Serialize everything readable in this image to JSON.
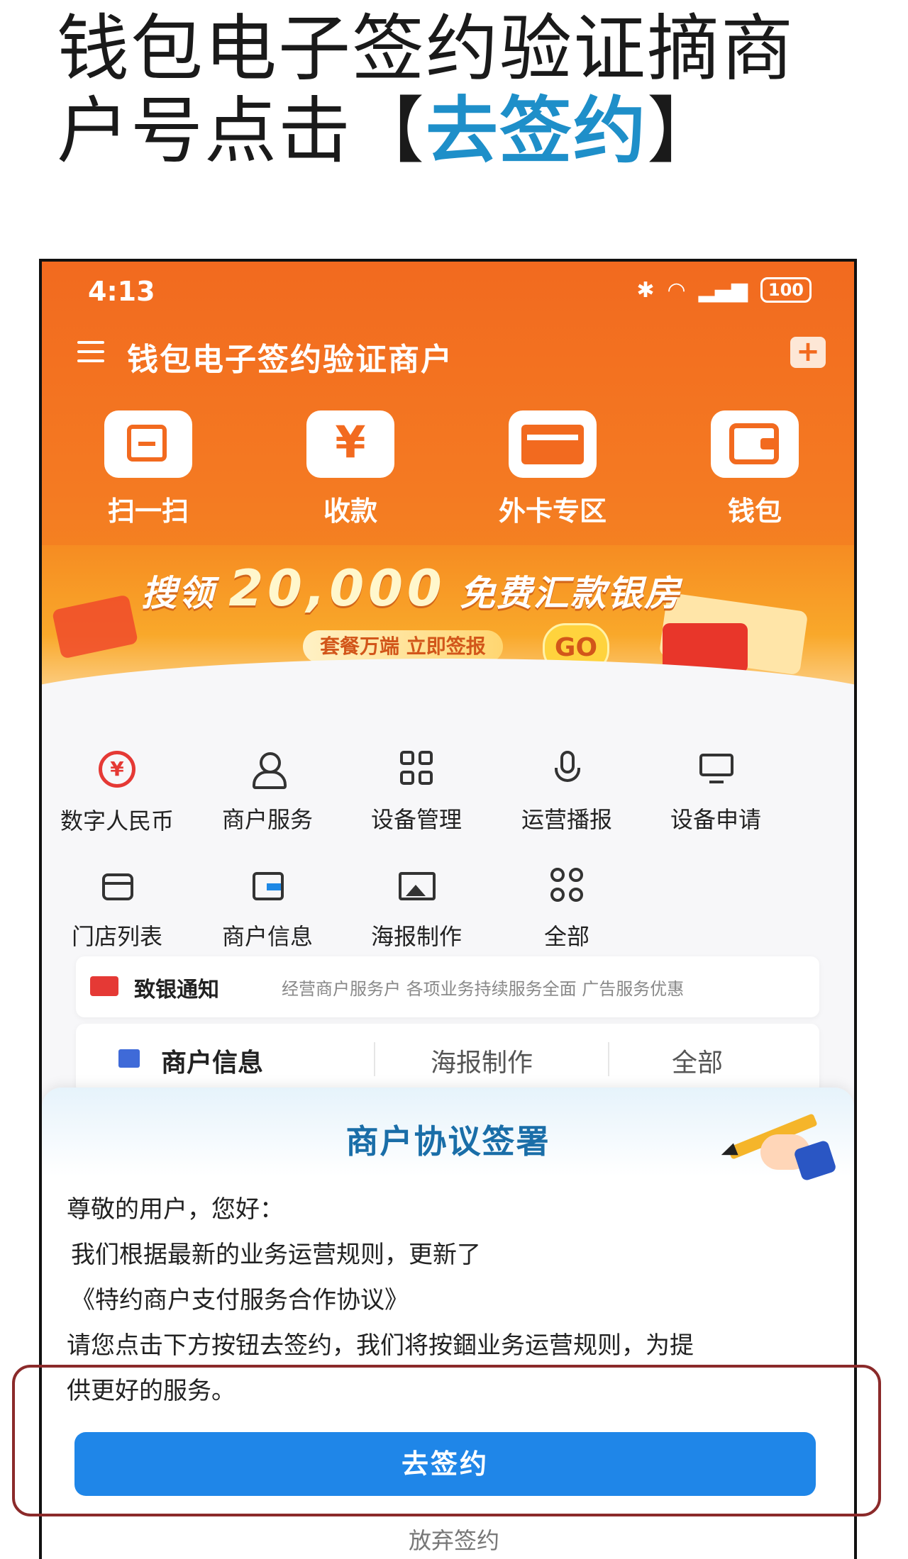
{
  "caption": {
    "line1": "钱包电子签约验证摘商",
    "line2_prefix": "户号点击【",
    "line2_highlight": "去签约",
    "line2_suffix": "】"
  },
  "status_bar": {
    "time": "4:13",
    "battery": "100"
  },
  "app_bar": {
    "title": "钱包电子签约验证商户",
    "plus_label": "+"
  },
  "quick_actions": [
    {
      "label": "扫一扫",
      "icon": "scan-icon"
    },
    {
      "label": "收款",
      "icon": "yen-icon"
    },
    {
      "label": "外卡专区",
      "icon": "card-icon"
    },
    {
      "label": "钱包",
      "icon": "wallet-icon"
    }
  ],
  "banner": {
    "headline_prefix": "搜领",
    "headline_amount": "20,000",
    "headline_suffix": "免费汇款银房",
    "sub_text": "套餐万端 立即签报",
    "go_label": "GO"
  },
  "services": [
    {
      "label": "数字人民币",
      "icon": "digital-rmb-icon"
    },
    {
      "label": "商户服务",
      "icon": "user-icon"
    },
    {
      "label": "设备管理",
      "icon": "grid-icon"
    },
    {
      "label": "运营播报",
      "icon": "microphone-icon"
    },
    {
      "label": "设备申请",
      "icon": "monitor-icon"
    },
    {
      "label": "门店列表",
      "icon": "store-icon"
    },
    {
      "label": "商户信息",
      "icon": "id-card-icon"
    },
    {
      "label": "海报制作",
      "icon": "image-icon"
    },
    {
      "label": "全部",
      "icon": "all-grid-icon"
    }
  ],
  "notice": {
    "title": "致银通知",
    "text": "经营商户服务户    各项业务持续服务全面   广告服务优惠"
  },
  "tabs": [
    {
      "label": "商户信息"
    },
    {
      "label": "海报制作"
    },
    {
      "label": "全部"
    }
  ],
  "agreement_sheet": {
    "title": "商户协议签署",
    "greeting": "尊敬的用户，您好：",
    "line1": "我们根据最新的业务运营规则，更新了",
    "line2": "《特约商户支付服务合作协议》",
    "line3": "请您点击下方按钮去签约，我们将按錮业务运营规则，为提",
    "line4": "供更好的服务。",
    "sign_button": "去签约",
    "abandon_link": "放弃签约"
  },
  "colors": {
    "brand_orange": "#f26a1f",
    "primary_blue": "#1f86e8",
    "caption_highlight": "#1e8fc9",
    "highlight_box": "#8b2a2a"
  }
}
